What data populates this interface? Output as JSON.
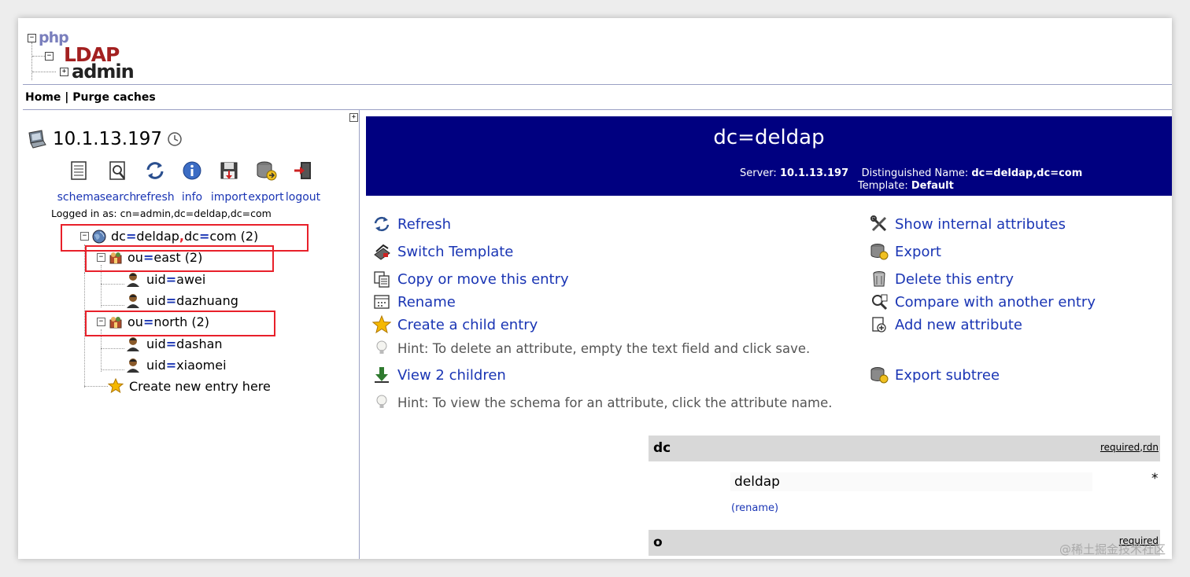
{
  "logo": {
    "php": "php",
    "ldap": "LDAP",
    "admin": "admin"
  },
  "menu": {
    "home": "Home",
    "sep": "|",
    "purge": "Purge caches"
  },
  "server": {
    "host": "10.1.13.197"
  },
  "toolbar": [
    {
      "label": "schema",
      "icon": "schema-icon"
    },
    {
      "label": "search",
      "icon": "search-icon"
    },
    {
      "label": "refresh",
      "icon": "refresh-icon"
    },
    {
      "label": "info",
      "icon": "info-icon"
    },
    {
      "label": "import",
      "icon": "import-icon"
    },
    {
      "label": "export",
      "icon": "export-icon"
    },
    {
      "label": "logout",
      "icon": "logout-icon"
    }
  ],
  "logged_in": "Logged in as: cn=admin,dc=deldap,dc=com",
  "tree": {
    "root": {
      "a": "dc",
      "eq": "=",
      "b": "deldap",
      "comma": ",",
      "c": "dc",
      "eq2": "=",
      "d": "com (2)"
    },
    "east": {
      "a": "ou",
      "eq": "=",
      "b": "east (2)"
    },
    "awei": {
      "a": "uid",
      "eq": "=",
      "b": "awei"
    },
    "dazhuang": {
      "a": "uid",
      "eq": "=",
      "b": "dazhuang"
    },
    "north": {
      "a": "ou",
      "eq": "=",
      "b": "north (2)"
    },
    "dashan": {
      "a": "uid",
      "eq": "=",
      "b": "dashan"
    },
    "xiaomei": {
      "a": "uid",
      "eq": "=",
      "b": "xiaomei"
    },
    "create": "Create new entry here"
  },
  "banner": {
    "title": "dc=deldap",
    "server_label": "Server:",
    "server_value": "10.1.13.197",
    "dn_label": "Distinguished Name:",
    "dn_value": "dc=deldap,dc=com",
    "template_label": "Template:",
    "template_value": "Default"
  },
  "actions": {
    "refresh": "Refresh",
    "switch_template": "Switch Template",
    "copy_move": "Copy or move this entry",
    "rename": "Rename",
    "create_child": "Create a child entry",
    "hint_delete": "Hint: To delete an attribute, empty the text field and click save.",
    "view_children": "View 2 children",
    "hint_schema": "Hint: To view the schema for an attribute, click the attribute name.",
    "show_internal": "Show internal attributes",
    "export": "Export",
    "delete_entry": "Delete this entry",
    "compare": "Compare with another entry",
    "add_attribute": "Add new attribute",
    "export_subtree": "Export subtree"
  },
  "attributes": {
    "dc": {
      "name": "dc",
      "flags_required": "required",
      "flags_sep": ", ",
      "flags_rdn": "rdn",
      "value": "deldap",
      "marker": "*",
      "rename_open": "(",
      "rename_link": "rename",
      "rename_close": ")"
    },
    "o": {
      "name": "o",
      "flags_required": "required"
    }
  },
  "watermark": "@稀土掘金技术社区",
  "colors": {
    "banner": "#000080",
    "link": "#1a35b4",
    "highlight": "#e8202a"
  }
}
